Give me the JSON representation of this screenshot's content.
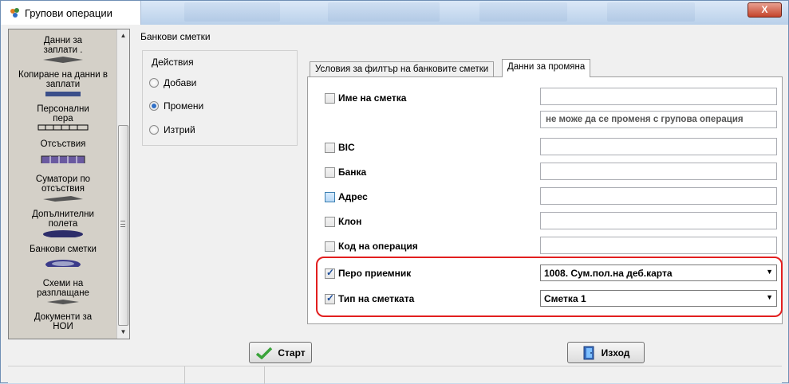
{
  "window": {
    "title": "Групови операции",
    "close_label": "X"
  },
  "sidebar": {
    "items": [
      {
        "label": "Данни за заплати .",
        "icon": "payroll-data-icon"
      },
      {
        "label": "Копиране на данни в заплати",
        "icon": "copy-payroll-icon"
      },
      {
        "label": "Персонални пера",
        "icon": "personal-items-icon"
      },
      {
        "label": "Отсъствия",
        "icon": "absences-icon"
      },
      {
        "label": "Суматори по отсъствия",
        "icon": "absence-summators-icon"
      },
      {
        "label": "Допълнителни полета",
        "icon": "additional-fields-icon"
      },
      {
        "label": "Банкови сметки",
        "icon": "bank-accounts-icon"
      },
      {
        "label": "Схеми на разплащане",
        "icon": "payment-schemes-icon"
      },
      {
        "label": "Документи за НОИ",
        "icon": "noi-documents-icon"
      }
    ]
  },
  "group": {
    "title": "Банкови сметки"
  },
  "actions": {
    "legend": "Действия",
    "options": [
      "Добави",
      "Промени",
      "Изтрий"
    ],
    "selected": "Промени"
  },
  "tabs": [
    {
      "label": "Условия за филтър на банковите сметки",
      "active": false
    },
    {
      "label": "Данни за промяна",
      "active": true
    }
  ],
  "fields": {
    "account_name": {
      "label": "Име на сметка",
      "checked": false,
      "value": ""
    },
    "account_name_hint": "не може да се променя с групова операция",
    "bic": {
      "label": "BIC",
      "checked": false,
      "value": ""
    },
    "bank": {
      "label": "Банка",
      "checked": false,
      "value": ""
    },
    "address": {
      "label": "Адрес",
      "checked": false,
      "value": ""
    },
    "branch": {
      "label": "Клон",
      "checked": false,
      "value": ""
    },
    "operation_code": {
      "label": "Код на операция",
      "checked": false,
      "value": ""
    },
    "receiver_item": {
      "label": "Перо приемник",
      "checked": true,
      "value": "1008. Сум.пол.на деб.карта"
    },
    "account_type": {
      "label": "Тип на сметката",
      "checked": true,
      "value": "Сметка 1"
    }
  },
  "buttons": {
    "start": "Старт",
    "exit": "Изход"
  },
  "colors": {
    "highlight": "#e21f1f",
    "accent": "#2f6fc6",
    "start_icon": "#3aa33a"
  }
}
